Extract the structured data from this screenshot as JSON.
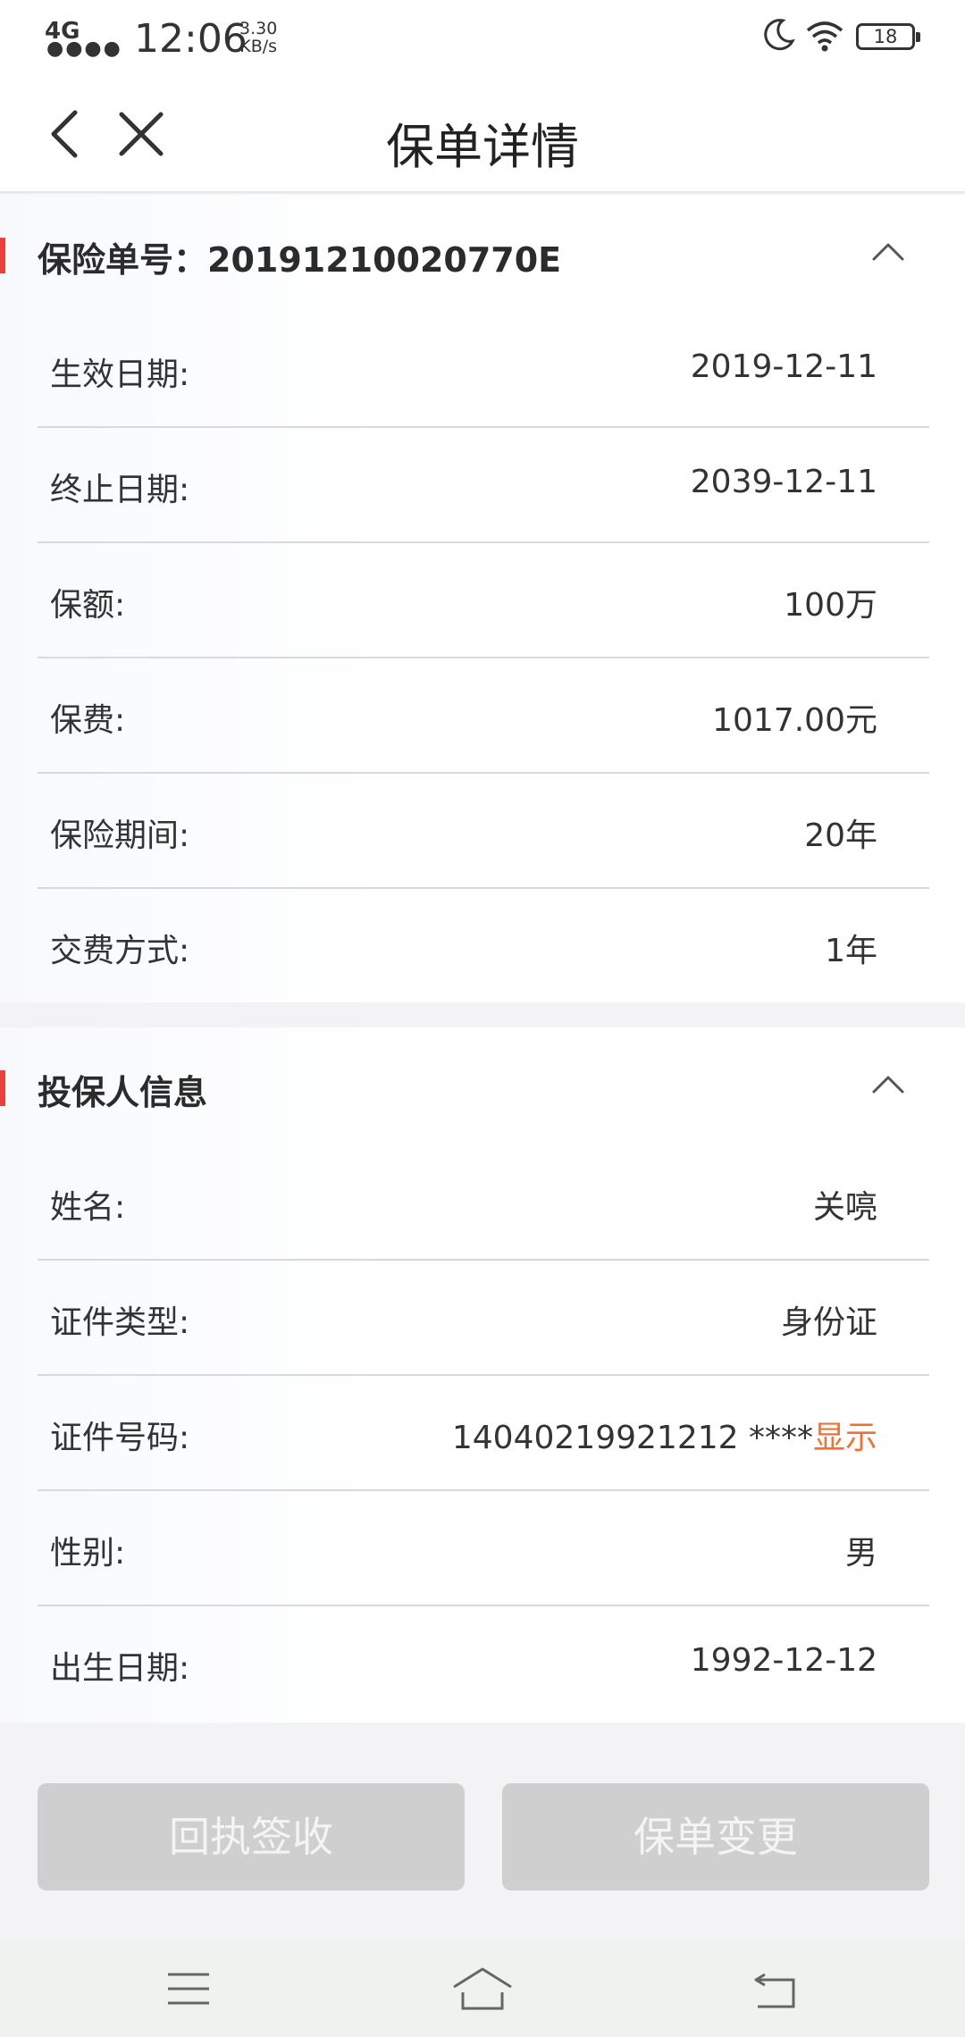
{
  "status_bar": {
    "network": "4G",
    "signal_dots": "●●●●",
    "time": "12:06",
    "speed_value": "3.30",
    "speed_unit": "KB/s",
    "battery": "18"
  },
  "navbar": {
    "title": "保单详情",
    "back_icon": "chevron-left-icon",
    "close_icon": "close-icon"
  },
  "policy_section": {
    "title": "保险单号：20191210020770E",
    "rows": [
      {
        "label": "生效日期:",
        "value": "2019-12-11"
      },
      {
        "label": "终止日期:",
        "value": "2039-12-11"
      },
      {
        "label": "保额:",
        "value": "100万"
      },
      {
        "label": "保费:",
        "value": "1017.00元"
      },
      {
        "label": "保险期间:",
        "value": "20年"
      },
      {
        "label": "交费方式:",
        "value": "1年"
      }
    ]
  },
  "holder_section": {
    "title": "投保人信息",
    "rows": [
      {
        "label": "姓名:",
        "value": "关喨"
      },
      {
        "label": "证件类型:",
        "value": "身份证"
      },
      {
        "label": "证件号码:",
        "value": "14040219921212 ****",
        "link": "显示"
      },
      {
        "label": "性别:",
        "value": "男"
      },
      {
        "label": "出生日期:",
        "value": "1992-12-12"
      }
    ]
  },
  "buttons": {
    "receipt": "回执签收",
    "change": "保单变更"
  },
  "colors": {
    "accent_bar": "#e8413c",
    "link": "#e8743a",
    "button_disabled": "#cfcfcf"
  }
}
